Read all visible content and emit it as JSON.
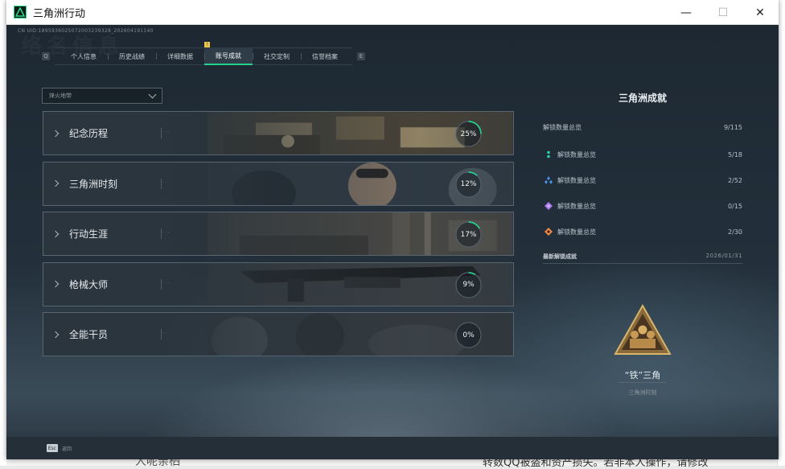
{
  "window": {
    "title": "三角洲行动",
    "min_glyph": "—",
    "max_glyph": "☐",
    "close_glyph": "✕"
  },
  "game": {
    "uid_line": "CN UID:1895936025072003239328_202604191140",
    "watermark": "络名信息",
    "tab_key_left": "Q",
    "tab_key_right": "E",
    "badge": "!",
    "tabs": [
      {
        "label": "个人信息",
        "active": false
      },
      {
        "label": "历史战绩",
        "active": false
      },
      {
        "label": "详细数据",
        "active": false
      },
      {
        "label": "账号成就",
        "active": true
      },
      {
        "label": "社交定制",
        "active": false
      },
      {
        "label": "信誉档案",
        "active": false
      }
    ],
    "dropdown": {
      "value": "烽火地带"
    },
    "categories": [
      {
        "label": "纪念历程",
        "progress": "25%",
        "fraction": 0.25
      },
      {
        "label": "三角洲时刻",
        "progress": "12%",
        "fraction": 0.12
      },
      {
        "label": "行动生涯",
        "progress": "17%",
        "fraction": 0.17
      },
      {
        "label": "枪械大师",
        "progress": "9%",
        "fraction": 0.09
      },
      {
        "label": "全能干员",
        "progress": "0%",
        "fraction": 0.0
      }
    ],
    "card_dots": "· · ·",
    "panel": {
      "title": "三角洲成就",
      "total_label": "解锁数量总览",
      "total_value": "9/115",
      "rows": [
        {
          "label": "解锁数量总览",
          "value": "5/18",
          "icon": "green-tier-icon",
          "color": "#2fd1a0"
        },
        {
          "label": "解锁数量总览",
          "value": "2/52",
          "icon": "blue-tier-icon",
          "color": "#4a8fe8"
        },
        {
          "label": "解锁数量总览",
          "value": "0/15",
          "icon": "purple-tier-icon",
          "color": "#a77bef"
        },
        {
          "label": "解锁数量总览",
          "value": "2/30",
          "icon": "orange-tier-icon",
          "color": "#f08a4b"
        }
      ],
      "latest_label": "最新解锁成就",
      "latest_date": "2026/01/31",
      "medal_name": "“铁”三角",
      "medal_category": "三角洲时刻"
    },
    "esc_key": "Esc",
    "esc_label": "返回"
  },
  "colors": {
    "accent": "#25d08f",
    "ring_track": "#55616b"
  },
  "desktop": {
    "bottom_text": "转数QQ被盗和资产损失。若非本人操作，请修改",
    "bottom_text2": "人呢亲栖"
  }
}
